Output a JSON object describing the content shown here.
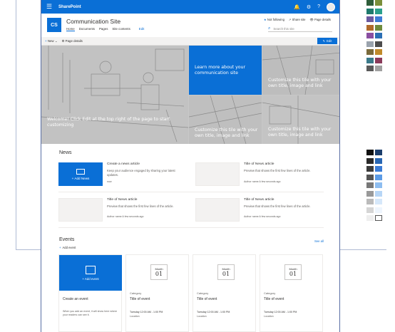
{
  "suite_bar": {
    "app_name": "SharePoint",
    "waffle": "☰",
    "icons": [
      "bell-icon",
      "gear-icon",
      "help-icon"
    ],
    "bell": "🔔",
    "gear": "⚙",
    "help": "?"
  },
  "site": {
    "logo": "CS",
    "title": "Communication Site",
    "nav": [
      "Home",
      "Documents",
      "Pages",
      "Site contents"
    ],
    "edit_link": "Edit",
    "actions": {
      "following": "Not following",
      "share": "Share site",
      "views": "Page details"
    },
    "search_placeholder": "Search this site"
  },
  "command_bar": {
    "new": "New",
    "page_details": "Page details",
    "edit": "Edit"
  },
  "hero": {
    "main_text": "Welcome! Click Edit at the top right of the page to start customizing",
    "blue_text": "Learn more about your communication site",
    "tile_text": "Customize this tile with your own title, image and link"
  },
  "news": {
    "heading": "News",
    "add_label": "Add News",
    "create_title": "Create a news article",
    "create_desc": "Keep your audience engaged by sharing your latest updates.",
    "create_meta": "now",
    "article_title": "Title of News article",
    "article_desc": "Preview that shows the first few lines of the article.",
    "article_meta": "Author name  A few seconds ago"
  },
  "events": {
    "heading": "Events",
    "see_all": "See all",
    "add_event_link": "Add event",
    "add_event": "Add event",
    "create_title": "Create an event",
    "create_desc": "When you add an event, it will show here where your readers can see it.",
    "month": "Month",
    "day": "01",
    "category": "Category",
    "title": "Title of event",
    "time": "Tuesday 12:00 AM - 1:00 PM",
    "location": "Location"
  },
  "palette": {
    "top": [
      "#2f5d3a",
      "#7a8f3a",
      "#1f7a6d",
      "#2aa08c",
      "#6b5aa0",
      "#3d7bd6",
      "#b06a2b",
      "#6e8b3d",
      "#8a4fa1",
      "#2b6fb5",
      "#9aa3ad",
      "#4c4c4c",
      "#7a6a3a",
      "#c08a2a",
      "#3a7a8a",
      "#8a3a5a",
      "#5a5a5a",
      "#a0a0a0"
    ],
    "bottom": [
      "#111111",
      "#1b3d6b",
      "#2a2a2a",
      "#2866b3",
      "#3b3b3b",
      "#3a7bd5",
      "#555555",
      "#5b9be6",
      "#777777",
      "#8dbdf0",
      "#999999",
      "#b7d6f6",
      "#bbbbbb",
      "#d6e8fa",
      "#d5d5d5",
      "#eef5fd",
      "#eeeeee",
      "#ffffff"
    ]
  }
}
